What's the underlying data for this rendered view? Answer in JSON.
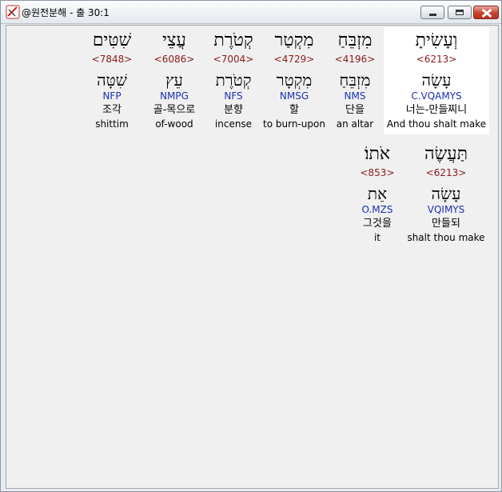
{
  "window": {
    "title": "@원전분해 - 출 30:1"
  },
  "words": [
    {
      "hebrew": "וְעָשִׂיתָ",
      "strong": "<6213>",
      "lemma": "עָשָׂה",
      "morph": "C.VQAMYS",
      "korean": "너는-만들찌니",
      "english": "And thou shalt make"
    },
    {
      "hebrew": "מִזְבֵּחַ",
      "strong": "<4196>",
      "lemma": "מִזְבֵּחַ",
      "morph": "NMS",
      "korean": "단을",
      "english": "an altar"
    },
    {
      "hebrew": "מִקְטַר",
      "strong": "<4729>",
      "lemma": "מִקְטָר",
      "morph": "NMSG",
      "korean": "할",
      "english": "to burn-upon"
    },
    {
      "hebrew": "קְטֹרֶת",
      "strong": "<7004>",
      "lemma": "קְטֹרֶת",
      "morph": "NFS",
      "korean": "분향",
      "english": "incense"
    },
    {
      "hebrew": "עֲצֵי",
      "strong": "<6086>",
      "lemma": "עֵץ",
      "morph": "NMPG",
      "korean": "골-목으로",
      "english": "of-wood"
    },
    {
      "hebrew": "שִׁטִּים",
      "strong": "<7848>",
      "lemma": "שִׁטָּה",
      "morph": "NFP",
      "korean": "조각",
      "english": "shittim"
    },
    {
      "hebrew": "תַּעֲשֶׂה",
      "strong": "<6213>",
      "lemma": "עָשָׂה",
      "morph": "VQIMYS",
      "korean": "만들되",
      "english": "shalt thou make"
    },
    {
      "hebrew": "אֹתוֹ׃",
      "strong": "<853>",
      "lemma": "אֵת",
      "morph": "O.MZS",
      "korean": "그것을",
      "english": "it"
    }
  ]
}
